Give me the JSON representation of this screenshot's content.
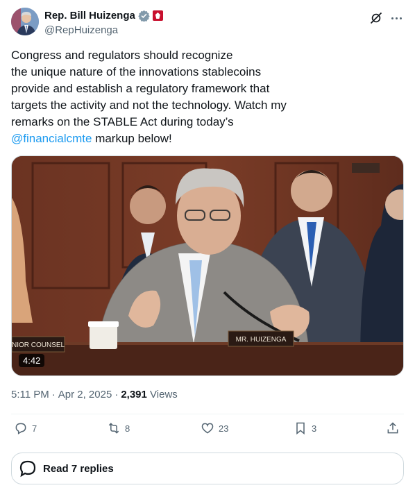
{
  "author": {
    "display_name": "Rep. Bill Huizenga",
    "handle": "@RepHuizenga",
    "verified_icon": "government-verified-badge",
    "affiliation_icon": "house-seal"
  },
  "tweet": {
    "text_lines": [
      "Congress and regulators should recognize",
      "the unique nature of the innovations stablecoins",
      "provide and establish a regulatory framework that",
      "targets the activity and not the technology. Watch my",
      "remarks on the STABLE Act during today’s"
    ],
    "mention": "@financialcmte",
    "after_mention": " markup below!"
  },
  "video": {
    "duration": "4:42",
    "nameplate": "MR. HUIZENGA",
    "left_plate": "NIOR COUNSEL"
  },
  "meta": {
    "time": "5:11 PM",
    "sep1": "·",
    "date": "Apr 2, 2025",
    "sep2": "·",
    "views_count": "2,391",
    "views_label": "Views"
  },
  "actions": {
    "replies": "7",
    "reposts": "8",
    "likes": "23",
    "bookmarks": "3"
  },
  "read_replies": "Read 7 replies",
  "colors": {
    "link": "#1d9bf0",
    "secondary": "#536471",
    "text": "#0f1419"
  }
}
